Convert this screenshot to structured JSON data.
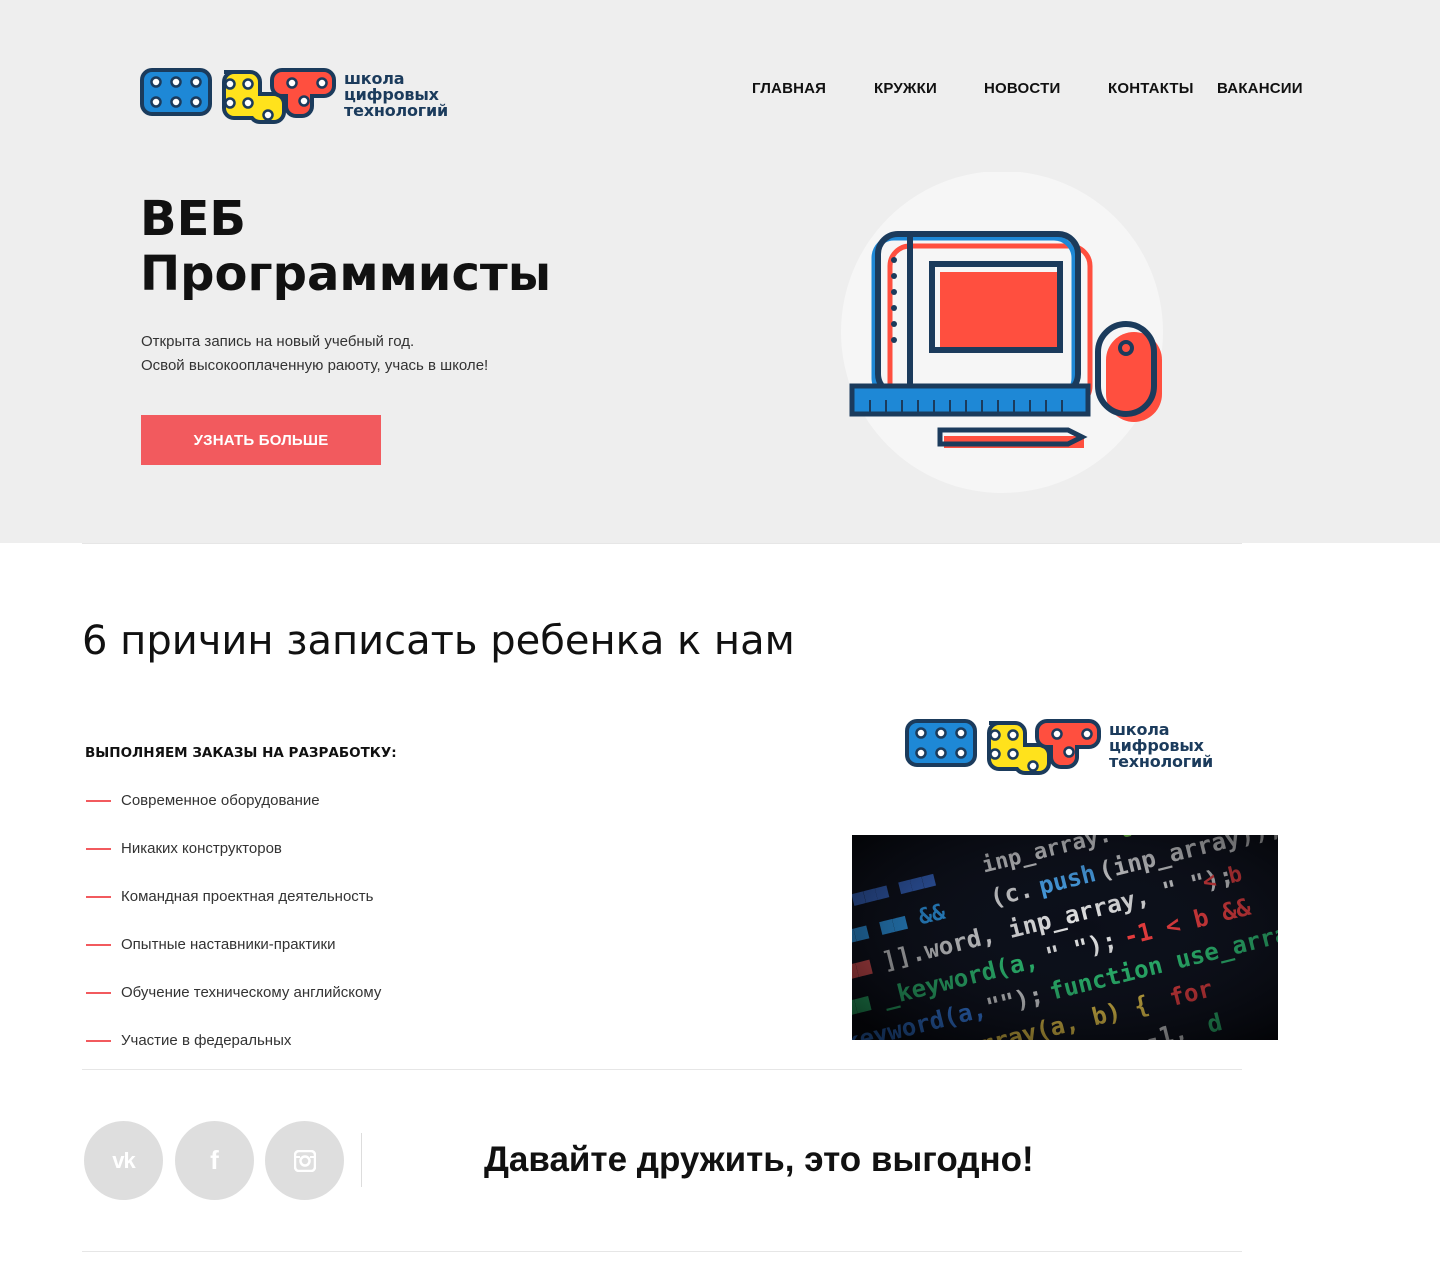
{
  "brand": {
    "line1": "школа",
    "line2": "цифровых",
    "line3": "технологий"
  },
  "nav": {
    "items": [
      {
        "label": "ГЛАВНАЯ"
      },
      {
        "label": "КРУЖКИ"
      },
      {
        "label": "НОВОСТИ"
      },
      {
        "label": "КОНТАКТЫ"
      },
      {
        "label": "ВАКАНСИИ"
      }
    ]
  },
  "hero": {
    "title_line1": "ВЕБ",
    "title_line2": "Программисты",
    "subtitle_line1": "Открыта запись на новый учебный год.",
    "subtitle_line2": "Освой высокооплаченную раюоту, учась в школе!",
    "button_label": "УЗНАТЬ БОЛЬШЕ"
  },
  "reasons": {
    "title": "6 причин записать ребенка к нам",
    "orders_heading": "ВЫПОЛНЯЕМ ЗАКАЗЫ НА РАЗРАБОТКУ:",
    "items": [
      "Современное оборудование",
      "Никаких конструкторов",
      "Командная проектная деятельность",
      "Опытные наставники-практики",
      "Обучение техническому английскому",
      "Участие в федеральных"
    ]
  },
  "social": {
    "vk_glyph": "vk",
    "fb_glyph": "f",
    "icons": [
      "vk-icon",
      "facebook-icon",
      "instagram-icon"
    ],
    "tagline": "Давайте дружить, это выгодно!"
  },
  "colors": {
    "accent": "#f25a5e",
    "hero_bg": "#eeeeee",
    "brand_blue": "#1e88d6",
    "brand_yellow": "#ffe21c",
    "brand_red": "#ff4f3f",
    "brand_navy": "#1b3b5c",
    "social_bg": "#dedede"
  }
}
